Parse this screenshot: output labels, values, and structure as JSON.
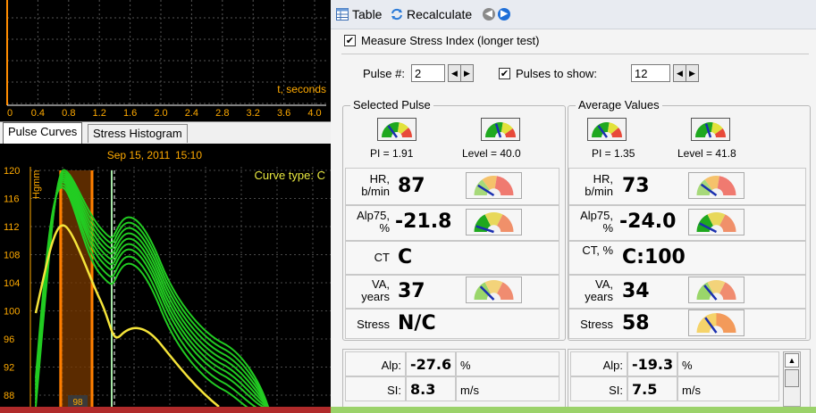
{
  "top_chart": {
    "x_ticks": [
      "0",
      "0.4",
      "0.8",
      "1.2",
      "1.6",
      "2.0",
      "2.4",
      "2.8",
      "3.2",
      "3.6",
      "4.0"
    ],
    "xlabel": "t, seconds"
  },
  "tabs": [
    {
      "label": "Pulse Curves",
      "active": true
    },
    {
      "label": "Stress Histogram",
      "active": false
    }
  ],
  "main_chart": {
    "date": "Sep 15, 2011",
    "time": "15:10",
    "curve_type": "Curve type: C",
    "ylabel": "Hgmm",
    "y_ticks": [
      "120",
      "116",
      "112",
      "108",
      "104",
      "100",
      "96",
      "92",
      "88"
    ],
    "marker_label": "98"
  },
  "toolbar": {
    "table_label": "Table",
    "recalc_label": "Recalculate"
  },
  "measure_stress": {
    "checked": true,
    "label": "Measure Stress Index (longer test)"
  },
  "pulse": {
    "label": "Pulse #:",
    "value": "2"
  },
  "pulses_to_show": {
    "checked": true,
    "label": "Pulses to show:",
    "value": "12"
  },
  "selected": {
    "title": "Selected Pulse",
    "pi": "PI = 1.91",
    "level": "Level = 40.0",
    "hr_label": "HR, b/min",
    "hr": "87",
    "alp75_label": "Alp75, %",
    "alp75": "-21.8",
    "ct_label": "CT",
    "ct": "C",
    "va_label": "VA, years",
    "va": "37",
    "stress_label": "Stress",
    "stress": "N/C"
  },
  "average": {
    "title": "Average Values",
    "pi": "PI = 1.35",
    "level": "Level = 41.8",
    "hr_label": "HR, b/min",
    "hr": "73",
    "alp75_label": "Alp75, %",
    "alp75": "-24.0",
    "ct_label": "CT, %",
    "ct": "C:100",
    "va_label": "VA, years",
    "va": "34",
    "stress_label": "Stress",
    "stress": "58"
  },
  "bottom_left": [
    {
      "label": "Alp:",
      "value": "-27.6",
      "unit": "%"
    },
    {
      "label": "SI:",
      "value": "8.3",
      "unit": "m/s"
    }
  ],
  "bottom_right": [
    {
      "label": "Alp:",
      "value": "-19.3",
      "unit": "%"
    },
    {
      "label": "SI:",
      "value": "7.5",
      "unit": "m/s"
    }
  ],
  "colors": {
    "curve": "#22cc22",
    "highlight": "#f5e43a",
    "orange": "#ff7f00",
    "tick": "#ffaa00"
  }
}
